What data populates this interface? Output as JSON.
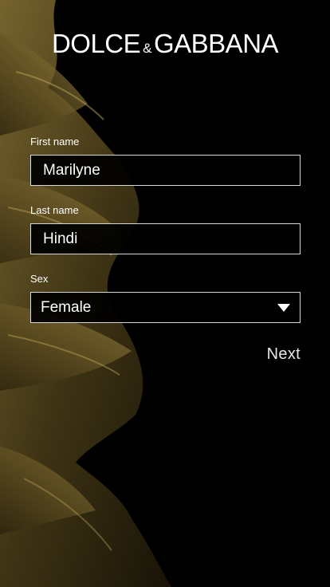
{
  "brand": {
    "part1": "DOLCE",
    "amp": "&",
    "part2": "GABBANA"
  },
  "form": {
    "first_name_label": "First name",
    "first_name_value": "Marilyne",
    "last_name_label": "Last name",
    "last_name_value": "Hindi",
    "sex_label": "Sex",
    "sex_value": "Female"
  },
  "actions": {
    "next_label": "Next"
  },
  "colors": {
    "background": "#000000",
    "foliage": "#6b5a26",
    "text": "#ffffff"
  }
}
